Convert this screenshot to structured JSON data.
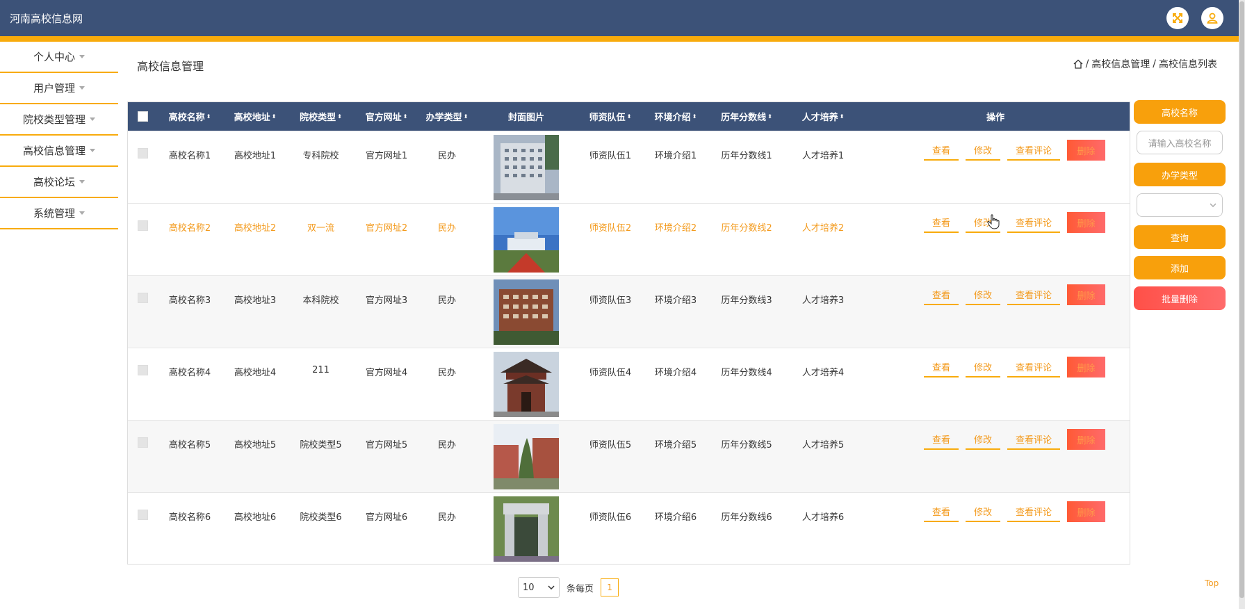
{
  "app": {
    "title": "河南高校信息网"
  },
  "header": {
    "icons": [
      "fullscreen-icon",
      "user-icon"
    ]
  },
  "sidebar": {
    "items": [
      {
        "label": "个人中心"
      },
      {
        "label": "用户管理"
      },
      {
        "label": "院校类型管理"
      },
      {
        "label": "高校信息管理"
      },
      {
        "label": "高校论坛"
      },
      {
        "label": "系统管理"
      }
    ]
  },
  "page": {
    "title": "高校信息管理",
    "breadcrumb": {
      "sep": "/",
      "level1": "高校信息管理",
      "level2": "高校信息列表"
    }
  },
  "table": {
    "columns": {
      "name": "高校名称",
      "address": "高校地址",
      "type": "院校类型",
      "website": "官方网址",
      "run": "办学类型",
      "cover": "封面图片",
      "teachers": "师资队伍",
      "environment": "环境介绍",
      "scores": "历年分数线",
      "talent": "人才培养",
      "ops": "操作"
    },
    "sort_glyph": "⬍",
    "rows": [
      {
        "name": "高校名称1",
        "address": "高校地址1",
        "type": "专科院校",
        "website": "官方网址1",
        "run": "民办",
        "teachers": "师资队伍1",
        "environment": "环境介绍1",
        "scores": "历年分数线1",
        "talent": "人才培养1"
      },
      {
        "name": "高校名称2",
        "address": "高校地址2",
        "type": "双一流",
        "website": "官方网址2",
        "run": "民办",
        "teachers": "师资队伍2",
        "environment": "环境介绍2",
        "scores": "历年分数线2",
        "talent": "人才培养2"
      },
      {
        "name": "高校名称3",
        "address": "高校地址3",
        "type": "本科院校",
        "website": "官方网址3",
        "run": "民办",
        "teachers": "师资队伍3",
        "environment": "环境介绍3",
        "scores": "历年分数线3",
        "talent": "人才培养3"
      },
      {
        "name": "高校名称4",
        "address": "高校地址4",
        "type": "211",
        "website": "官方网址4",
        "run": "民办",
        "teachers": "师资队伍4",
        "environment": "环境介绍4",
        "scores": "历年分数线4",
        "talent": "人才培养4"
      },
      {
        "name": "高校名称5",
        "address": "高校地址5",
        "type": "院校类型5",
        "website": "官方网址5",
        "run": "民办",
        "teachers": "师资队伍5",
        "environment": "环境介绍5",
        "scores": "历年分数线5",
        "talent": "人才培养5"
      },
      {
        "name": "高校名称6",
        "address": "高校地址6",
        "type": "院校类型6",
        "website": "官方网址6",
        "run": "民办",
        "teachers": "师资队伍6",
        "environment": "环境介绍6",
        "scores": "历年分数线6",
        "talent": "人才培养6"
      }
    ],
    "actions": {
      "view": "查看",
      "edit": "修改",
      "comments": "查看评论",
      "delete": "删除"
    }
  },
  "pagination": {
    "page_size": "10",
    "per_page_label": "条每页",
    "current_page": "1"
  },
  "search_panel": {
    "name_label": "高校名称",
    "name_placeholder": "请输入高校名称",
    "run_label": "办学类型",
    "run_value": "",
    "query": "查询",
    "add": "添加",
    "batch_delete": "批量删除"
  },
  "footer": {
    "top_link": "Top"
  },
  "colors": {
    "header": "#3c5278",
    "accent": "#f8ab0c",
    "danger": "#ff5a50"
  }
}
